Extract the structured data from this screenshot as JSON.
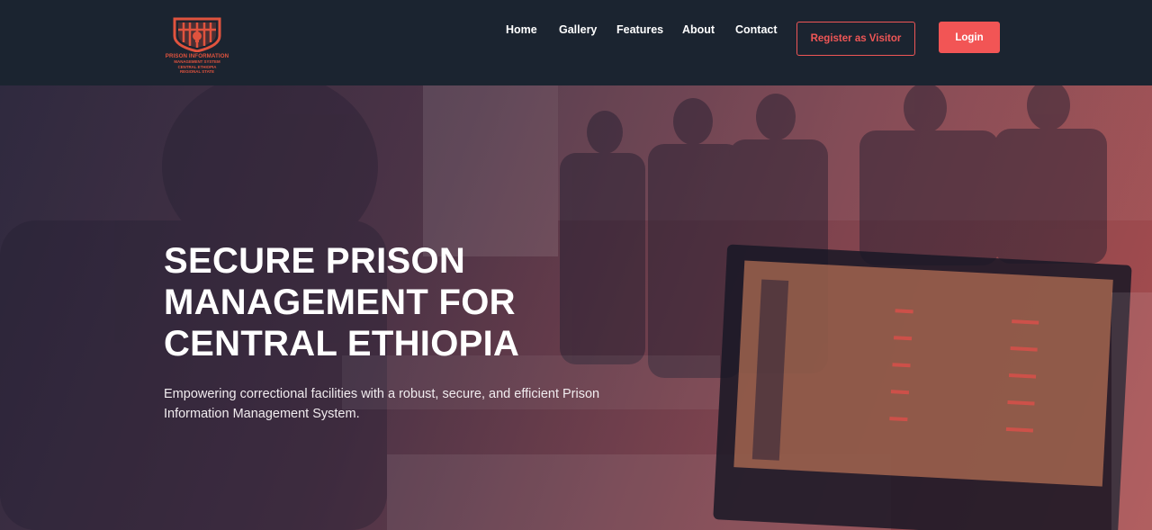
{
  "logo": {
    "line1": "PRISON INFORMATION",
    "line2": "MANAGEMENT SYSTEM",
    "line3": "CENTRAL ETHIOPIA",
    "line4": "REGIONAL STATE",
    "icon": "prison-gate-shield-icon"
  },
  "nav": {
    "items": [
      {
        "label": "Home"
      },
      {
        "label": "Gallery"
      },
      {
        "label": "Features"
      },
      {
        "label": "About"
      },
      {
        "label": "Contact"
      }
    ],
    "register_label": "Register as Visitor",
    "login_label": "Login"
  },
  "hero": {
    "title_line1": "SECURE PRISON",
    "title_line2": "MANAGEMENT FOR",
    "title_line3": "CENTRAL ETHIOPIA",
    "subtitle": "Empowering correctional facilities with a robust, secure, and efficient Prison Information Management System."
  },
  "colors": {
    "header_bg": "#1b2430",
    "accent": "#f25555",
    "logo": "#e0533e",
    "text": "#ffffff"
  }
}
